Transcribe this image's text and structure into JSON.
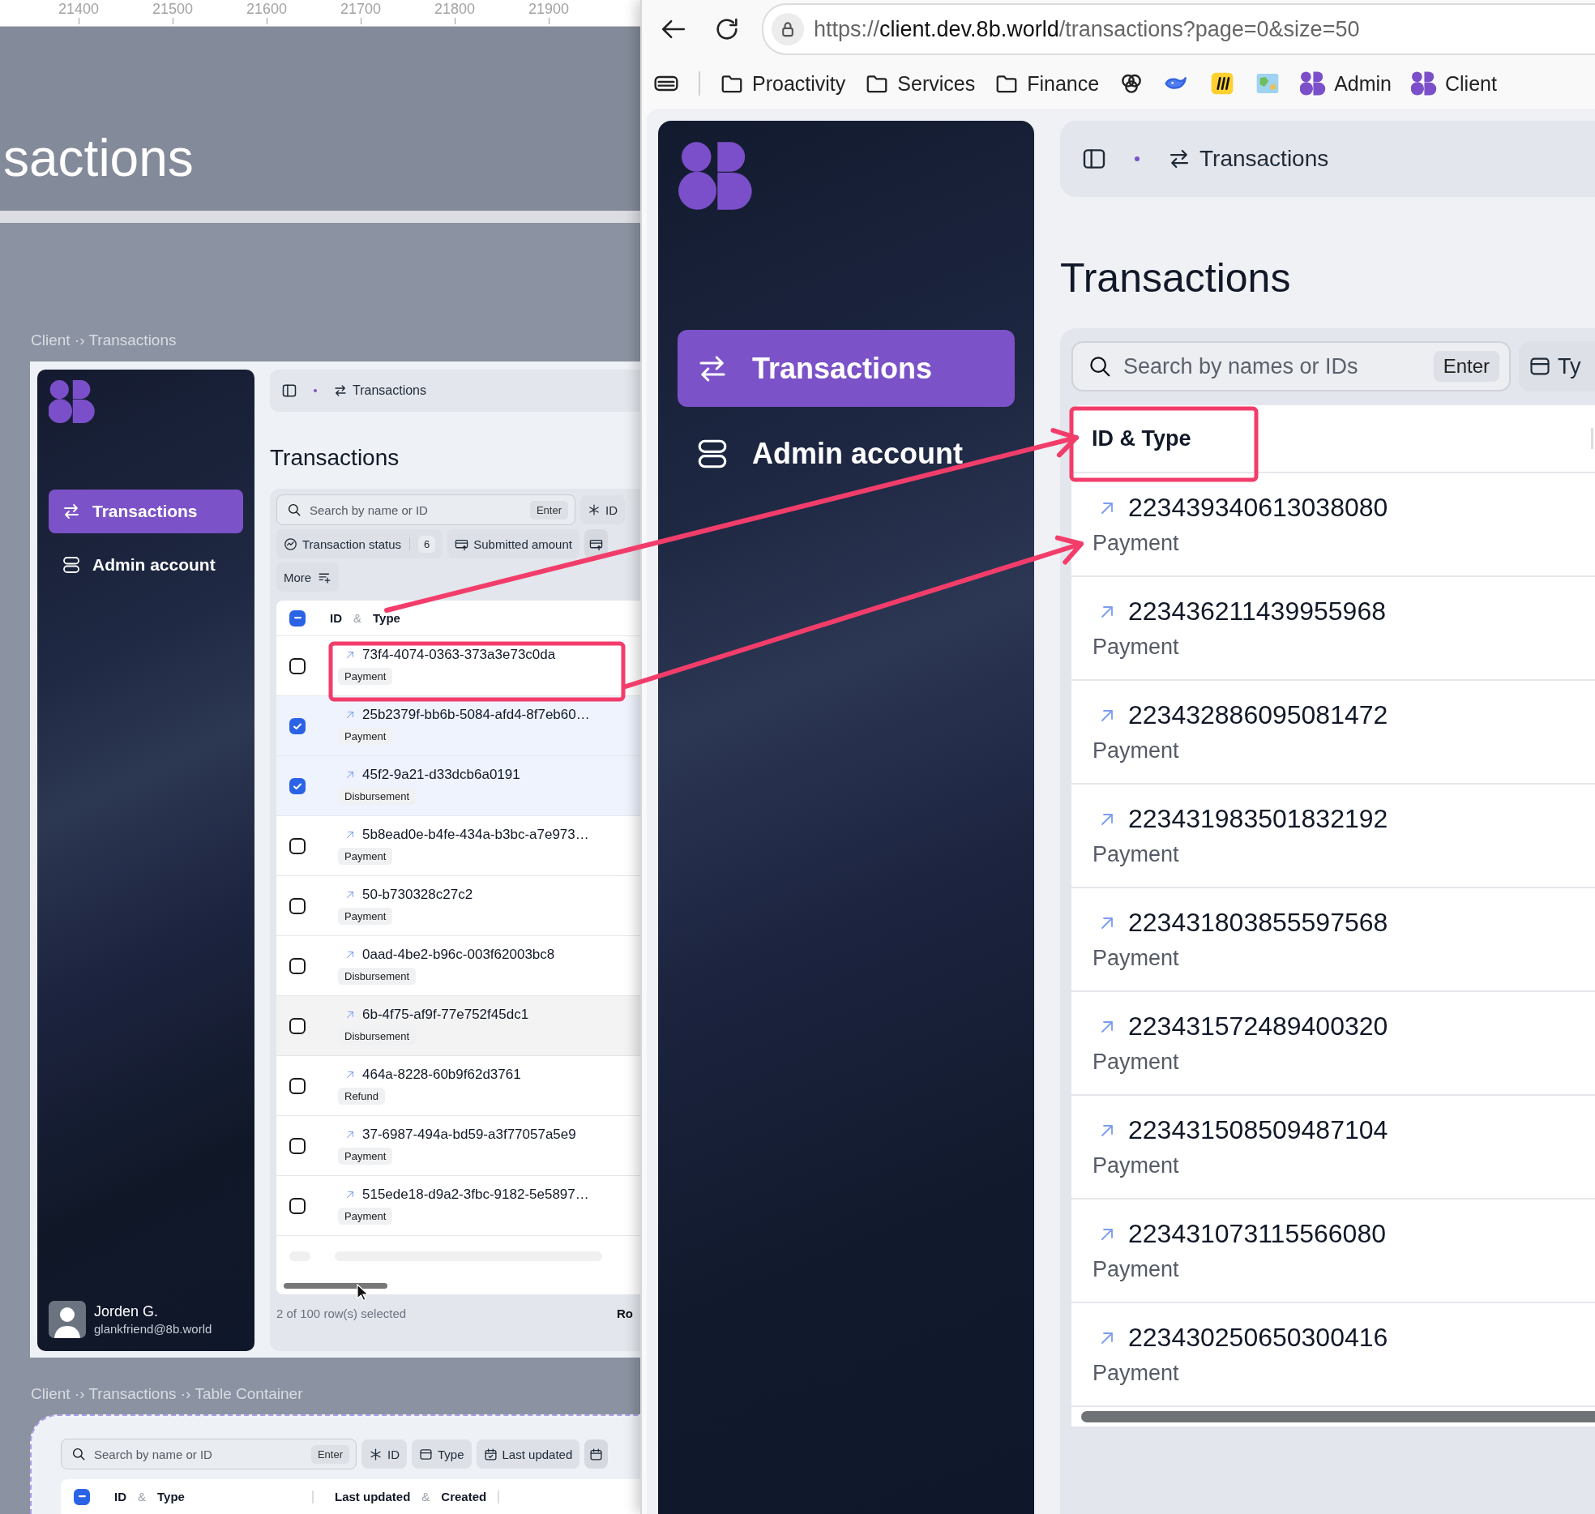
{
  "canvas_ruler": [
    "21400",
    "21500",
    "21600",
    "21700",
    "21800",
    "21900"
  ],
  "canvas_banner": "sactions",
  "client_frame": {
    "label": "Client ·› Transactions",
    "app": {
      "nav": [
        {
          "label": "Transactions",
          "selected": true
        },
        {
          "label": "Admin account",
          "selected": false
        }
      ],
      "user": {
        "name": "Jorden G.",
        "email": "glankfriend@8b.world"
      },
      "crumb": "Transactions",
      "title": "Transactions",
      "search": {
        "placeholder": "Search by name or ID",
        "key": "Enter"
      },
      "filters_row_1": [
        {
          "label": "ID"
        }
      ],
      "filters_row_2": [
        {
          "label": "Transaction status",
          "count": "6"
        },
        {
          "label": "Submitted amount"
        },
        {
          "kind": "icon_only"
        }
      ],
      "more": "More",
      "select_all": {
        "indeterminate": true
      },
      "columns": [
        {
          "text": "ID",
          "kind": "label"
        },
        {
          "text": "&",
          "kind": "joiner"
        },
        {
          "text": "Type",
          "kind": "label"
        }
      ],
      "rows": [
        {
          "id": "73f4-4074-0363-373a3e73c0da",
          "type": "Payment",
          "checked": false,
          "hovered": false
        },
        {
          "id": "25b2379f-bb6b-5084-afd4-8f7eb60…",
          "type": "Payment",
          "checked": true,
          "hovered": false
        },
        {
          "id": "45f2-9a21-d33dcb6a0191",
          "type": "Disbursement",
          "checked": true,
          "hovered": false
        },
        {
          "id": "5b8ead0e-b4fe-434a-b3bc-a7e973…",
          "type": "Payment",
          "checked": false,
          "hovered": false
        },
        {
          "id": "50-b730328c27c2",
          "type": "Payment",
          "checked": false,
          "hovered": false
        },
        {
          "id": "0aad-4be2-b96c-003f62003bc8",
          "type": "Disbursement",
          "checked": false,
          "hovered": false
        },
        {
          "id": "6b-4f75-af9f-77e752f45dc1",
          "type": "Disbursement",
          "checked": false,
          "hovered": true
        },
        {
          "id": "464a-8228-60b9f62d3761",
          "type": "Refund",
          "checked": false,
          "hovered": false
        },
        {
          "id": "37-6987-494a-bd59-a3f77057a5e9",
          "type": "Payment",
          "checked": false,
          "hovered": false
        },
        {
          "id": "515ede18-d9a2-3fbc-9182-5e5897…",
          "type": "Payment",
          "checked": false,
          "hovered": false
        }
      ],
      "loading_row": true,
      "footer": "2 of 100 row(s) selected",
      "footer_right": "Ro"
    }
  },
  "table_container_frame": {
    "label": "Client ·› Transactions ·› Table Container",
    "search": {
      "placeholder": "Search by name or ID",
      "key": "Enter"
    },
    "filters": [
      {
        "label": "ID"
      },
      {
        "label": "Type"
      },
      {
        "label": "Last updated"
      },
      {
        "kind": "icon_only"
      }
    ],
    "select_all": {
      "indeterminate": true
    },
    "column_groups": [
      [
        {
          "text": "ID",
          "kind": "label"
        },
        {
          "text": "&",
          "kind": "joiner"
        },
        {
          "text": "Type",
          "kind": "label"
        }
      ],
      [
        {
          "text": "Last updated",
          "kind": "label"
        },
        {
          "text": "&",
          "kind": "joiner"
        },
        {
          "text": "Created",
          "kind": "label"
        }
      ]
    ]
  },
  "browser": {
    "url_scheme": "https://",
    "url_host": "client.dev.8b.world",
    "url_path": "/transactions?page=0&size=50",
    "bookmarks": [
      {
        "kind": "icon"
      },
      {
        "kind": "folder",
        "label": "Proactivity"
      },
      {
        "kind": "folder",
        "label": "Services"
      },
      {
        "kind": "folder",
        "label": "Finance"
      },
      {
        "kind": "icon"
      },
      {
        "kind": "icon"
      },
      {
        "kind": "icon"
      },
      {
        "kind": "icon"
      },
      {
        "kind": "logo",
        "label": "Admin"
      },
      {
        "kind": "logo",
        "label": "Client"
      }
    ],
    "app": {
      "nav": [
        {
          "label": "Transactions",
          "selected": true
        },
        {
          "label": "Admin account",
          "selected": false
        }
      ],
      "crumb": "Transactions",
      "title": "Transactions",
      "search": {
        "placeholder": "Search by names or IDs",
        "key": "Enter"
      },
      "filters": [
        {
          "label": "Ty"
        }
      ],
      "column": "ID & Type",
      "rows": [
        {
          "id": "223439340613038080",
          "type": "Payment"
        },
        {
          "id": "223436211439955968",
          "type": "Payment"
        },
        {
          "id": "223432886095081472",
          "type": "Payment"
        },
        {
          "id": "223431983501832192",
          "type": "Payment"
        },
        {
          "id": "223431803855597568",
          "type": "Payment"
        },
        {
          "id": "223431572489400320",
          "type": "Payment"
        },
        {
          "id": "223431508509487104",
          "type": "Payment"
        },
        {
          "id": "223431073115566080",
          "type": "Payment"
        },
        {
          "id": "223430250650300416",
          "type": "Payment"
        }
      ]
    }
  }
}
